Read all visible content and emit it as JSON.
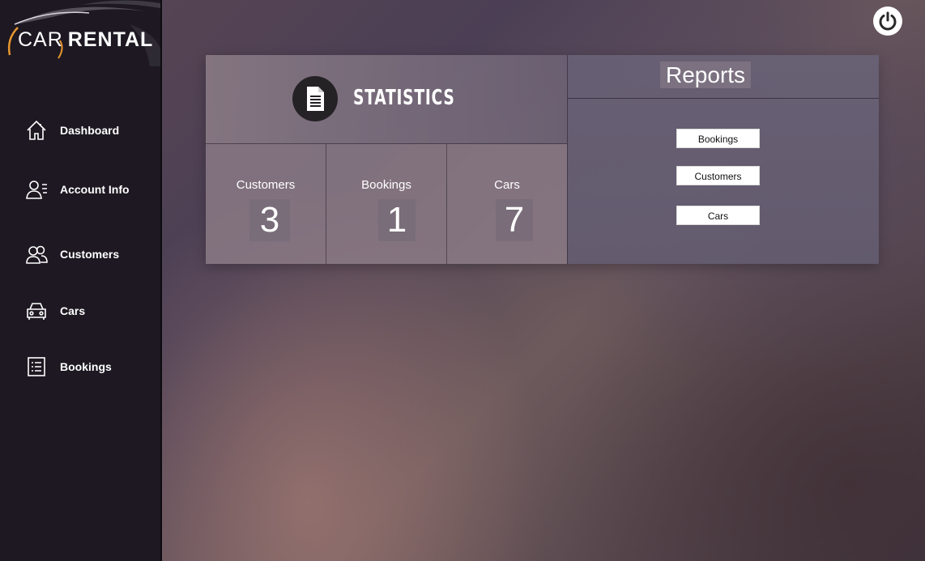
{
  "app": {
    "logo_part1": "CAR",
    "logo_part2": "RENTAL"
  },
  "sidebar": {
    "items": [
      {
        "label": "Dashboard",
        "icon": "home-icon"
      },
      {
        "label": "Account Info",
        "icon": "account-info-icon"
      },
      {
        "label": "Customers",
        "icon": "customers-icon"
      },
      {
        "label": "Cars",
        "icon": "car-icon"
      },
      {
        "label": "Bookings",
        "icon": "bookings-list-icon"
      }
    ]
  },
  "header": {
    "power_icon": "power-icon"
  },
  "statistics": {
    "title": "STATISTICS",
    "icon": "document-icon",
    "stats": [
      {
        "label": "Customers",
        "value": "3"
      },
      {
        "label": "Bookings",
        "value": "1"
      },
      {
        "label": "Cars",
        "value": "7"
      }
    ]
  },
  "reports": {
    "title": "Reports",
    "buttons": [
      {
        "label": "Bookings"
      },
      {
        "label": "Customers"
      },
      {
        "label": "Cars"
      }
    ]
  },
  "colors": {
    "sidebar_bg": "#1d1822",
    "accent_orange": "#e8962e",
    "text": "#ffffff"
  }
}
